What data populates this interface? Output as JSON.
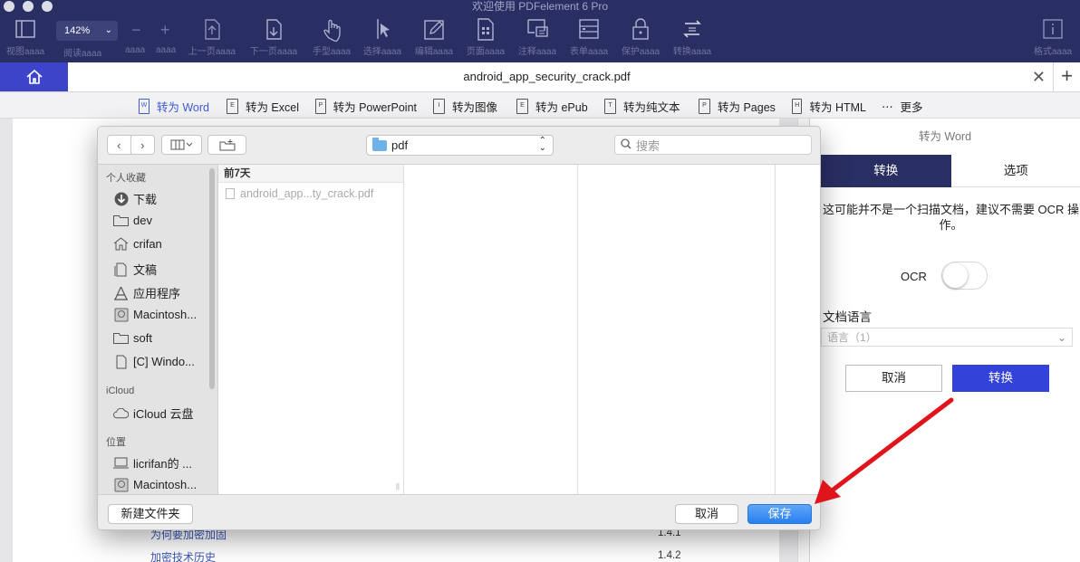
{
  "app": {
    "window_title": "欢迎使用 PDFelement 6 Pro",
    "zoom": "142%"
  },
  "toolbar": {
    "items": [
      {
        "label": "视图aaaa",
        "icon": "view-icon"
      },
      {
        "label": "阅读aaaa",
        "icon": "read-icon"
      },
      {
        "label": "上一页aaaa",
        "icon": "prev-page-icon"
      },
      {
        "label": "下一页aaaa",
        "icon": "next-page-icon"
      },
      {
        "label": "手型aaaa",
        "icon": "hand-icon"
      },
      {
        "label": "选择aaaa",
        "icon": "select-icon"
      },
      {
        "label": "编辑aaaa",
        "icon": "edit-icon"
      },
      {
        "label": "页面aaaa",
        "icon": "page-icon"
      },
      {
        "label": "注释aaaa",
        "icon": "comment-icon"
      },
      {
        "label": "表单aaaa",
        "icon": "form-icon"
      },
      {
        "label": "保护aaaa",
        "icon": "lock-icon"
      },
      {
        "label": "转换aaaa",
        "icon": "convert-icon"
      },
      {
        "label": "格式aaaa",
        "icon": "info-icon"
      }
    ],
    "zoom_label": "aaaa",
    "zoom_label2": "aaaa"
  },
  "tab": {
    "title": "android_app_security_crack.pdf"
  },
  "convert_bar": {
    "items": [
      {
        "label": "转为 Word",
        "tag": "W"
      },
      {
        "label": "转为 Excel",
        "tag": "E"
      },
      {
        "label": "转为 PowerPoint",
        "tag": "P"
      },
      {
        "label": "转为图像",
        "tag": "I"
      },
      {
        "label": "转为 ePub",
        "tag": "E"
      },
      {
        "label": "转为纯文本",
        "tag": "T"
      },
      {
        "label": "转为 Pages",
        "tag": "P"
      },
      {
        "label": "转为 HTML",
        "tag": "H"
      }
    ],
    "more_label": "更多"
  },
  "document": {
    "toc": [
      {
        "text": "为何要加密加固",
        "num": "1.4.1"
      },
      {
        "text": "加密技术历史",
        "num": "1.4.2"
      }
    ]
  },
  "right_panel": {
    "title": "转为 Word",
    "tab_convert": "转换",
    "tab_options": "选项",
    "note": "这可能并不是一个扫描文档，建议不需要 OCR 操作。",
    "ocr_label": "OCR",
    "ocr_enabled": false,
    "language_label": "文档语言",
    "language_value": "语言（1）",
    "cancel": "取消",
    "convert": "转换"
  },
  "dialog": {
    "location": "pdf",
    "search_placeholder": "搜索",
    "sidebar": {
      "favorites_header": "个人收藏",
      "favorites": [
        {
          "label": "下载",
          "icon": "download-icon"
        },
        {
          "label": "dev",
          "icon": "folder-icon"
        },
        {
          "label": "crifan",
          "icon": "home-icon"
        },
        {
          "label": "文稿",
          "icon": "documents-icon"
        },
        {
          "label": "应用程序",
          "icon": "applications-icon"
        },
        {
          "label": "Macintosh...",
          "icon": "disk-icon"
        },
        {
          "label": "soft",
          "icon": "folder-icon"
        },
        {
          "label": "[C] Windo...",
          "icon": "file-icon"
        }
      ],
      "icloud_header": "iCloud",
      "icloud": [
        {
          "label": "iCloud 云盘",
          "icon": "cloud-icon"
        }
      ],
      "locations_header": "位置",
      "locations": [
        {
          "label": "licrifan的 ...",
          "icon": "computer-icon"
        },
        {
          "label": "Macintosh...",
          "icon": "disk-icon"
        }
      ]
    },
    "column_header": "前7天",
    "file": "android_app...ty_crack.pdf",
    "new_folder": "新建文件夹",
    "cancel": "取消",
    "save": "保存"
  },
  "colors": {
    "toolbar_bg": "#2a2f63",
    "accent_blue": "#3343d9",
    "save_blue": "#2a7ef0",
    "arrow_red": "#e0151b"
  }
}
